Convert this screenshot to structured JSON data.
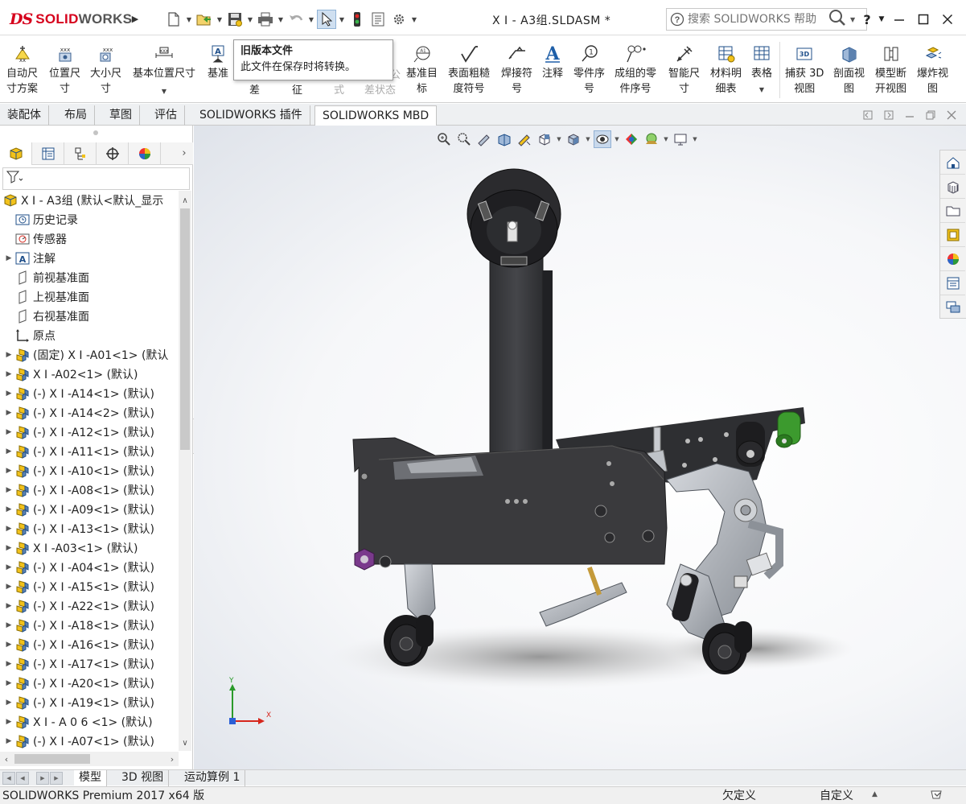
{
  "app": {
    "brand_prefix": "DS",
    "brand_solid": "SOLID",
    "brand_works": "WORKS",
    "document_title": "X I - A3组.SLDASM *",
    "help_placeholder": "搜索 SOLIDWORKS 帮助",
    "help_q": "?"
  },
  "tooltip": {
    "title": "旧版本文件",
    "body": "此文件在保存时将转换。"
  },
  "ribbon": [
    {
      "id": "auto-dim",
      "label1": "自动尺",
      "label2": "寸方案",
      "icon": "auto-dimension-icon"
    },
    {
      "id": "loc-dim",
      "label1": "位置尺",
      "label2": "寸",
      "icon": "location-dimension-icon"
    },
    {
      "id": "size-dim",
      "label1": "大小尺",
      "label2": "寸",
      "icon": "size-dimension-icon"
    },
    {
      "id": "basic-loc-dim",
      "label1": "基本位置尺寸",
      "label2": "",
      "icon": "basic-location-dimension-icon"
    },
    {
      "id": "datum",
      "label1": "基准",
      "label2": "",
      "icon": "datum-icon"
    },
    {
      "id": "datum-target",
      "label1": "基准目",
      "label2": "标",
      "icon": "datum-target-icon"
    },
    {
      "id": "surface-finish",
      "label1": "表面粗糙",
      "label2": "度符号",
      "icon": "surface-finish-icon"
    },
    {
      "id": "weld-symbol",
      "label1": "焊接符",
      "label2": "号",
      "icon": "weld-symbol-icon"
    },
    {
      "id": "note",
      "label1": "注释",
      "label2": "",
      "icon": "note-icon"
    },
    {
      "id": "balloon",
      "label1": "零件序",
      "label2": "号",
      "icon": "balloon-icon"
    },
    {
      "id": "stacked-balloon",
      "label1": "成组的零",
      "label2": "件序号",
      "icon": "stacked-balloon-icon"
    },
    {
      "id": "smart-dim",
      "label1": "智能尺",
      "label2": "寸",
      "icon": "smart-dimension-icon"
    },
    {
      "id": "bom",
      "label1": "材料明",
      "label2": "细表",
      "icon": "bill-of-materials-icon"
    },
    {
      "id": "table",
      "label1": "表格",
      "label2": "",
      "icon": "table-icon"
    },
    {
      "id": "capture-3d",
      "label1": "捕获 3D",
      "label2": "视图",
      "icon": "capture-3d-view-icon"
    },
    {
      "id": "section-view",
      "label1": "剖面视",
      "label2": "图",
      "icon": "section-view-icon"
    },
    {
      "id": "model-break",
      "label1": "模型断",
      "label2": "开视图",
      "icon": "model-break-view-icon"
    },
    {
      "id": "explode-view",
      "label1": "爆炸视",
      "label2": "图",
      "icon": "explode-view-icon"
    }
  ],
  "ribbon_hidden": {
    "row2_a": "差",
    "row2_b": "征",
    "row2_c": "式",
    "row2_d": "差状态",
    "row1_d": "公"
  },
  "command_tabs": [
    "装配体",
    "布局",
    "草图",
    "评估",
    "SOLIDWORKS 插件",
    "SOLIDWORKS MBD"
  ],
  "active_command_tab": "SOLIDWORKS MBD",
  "tree": {
    "root": "X I - A3组 (默认<默认_显示",
    "items": [
      {
        "label": "历史记录",
        "icon": "history-icon",
        "expand": false
      },
      {
        "label": "传感器",
        "icon": "sensor-icon",
        "expand": false
      },
      {
        "label": "注解",
        "icon": "annotations-icon",
        "expand": true
      },
      {
        "label": "前视基准面",
        "icon": "plane-icon",
        "expand": false
      },
      {
        "label": "上视基准面",
        "icon": "plane-icon",
        "expand": false
      },
      {
        "label": "右视基准面",
        "icon": "plane-icon",
        "expand": false
      },
      {
        "label": "原点",
        "icon": "origin-icon",
        "expand": false
      },
      {
        "label": "(固定) X I -A01<1> (默认",
        "icon": "part-icon",
        "expand": true
      },
      {
        "label": " X I -A02<1> (默认)",
        "icon": "part-icon",
        "expand": true
      },
      {
        "label": "(-) X I -A14<1> (默认)",
        "icon": "part-icon",
        "expand": true
      },
      {
        "label": "(-) X I -A14<2> (默认)",
        "icon": "part-icon",
        "expand": true
      },
      {
        "label": "(-) X I -A12<1> (默认)",
        "icon": "part-icon",
        "expand": true
      },
      {
        "label": "(-) X I -A11<1> (默认)",
        "icon": "part-icon",
        "expand": true
      },
      {
        "label": "(-) X I -A10<1> (默认)",
        "icon": "part-icon",
        "expand": true
      },
      {
        "label": "(-) X I -A08<1> (默认)",
        "icon": "part-icon",
        "expand": true
      },
      {
        "label": "(-) X I -A09<1> (默认)",
        "icon": "part-icon",
        "expand": true
      },
      {
        "label": "(-) X I -A13<1> (默认)",
        "icon": "part-icon",
        "expand": true
      },
      {
        "label": " X I -A03<1> (默认)",
        "icon": "part-icon",
        "expand": true
      },
      {
        "label": "(-) X I -A04<1> (默认)",
        "icon": "part-icon",
        "expand": true
      },
      {
        "label": "(-) X I -A15<1> (默认)",
        "icon": "part-icon",
        "expand": true
      },
      {
        "label": "(-) X I -A22<1> (默认)",
        "icon": "part-icon",
        "expand": true
      },
      {
        "label": "(-) X I -A18<1> (默认)",
        "icon": "part-icon",
        "expand": true
      },
      {
        "label": "(-) X I -A16<1> (默认)",
        "icon": "part-icon",
        "expand": true
      },
      {
        "label": "(-) X I -A17<1> (默认)",
        "icon": "part-icon",
        "expand": true
      },
      {
        "label": "(-) X I -A20<1> (默认)",
        "icon": "part-icon",
        "expand": true
      },
      {
        "label": "(-) X I -A19<1> (默认)",
        "icon": "part-icon",
        "expand": true
      },
      {
        "label": " X I - A 0 6 <1> (默认)",
        "icon": "part-icon",
        "expand": true
      },
      {
        "label": "(-) X I -A07<1> (默认)",
        "icon": "part-icon",
        "expand": true
      }
    ]
  },
  "bottom_tabs": [
    "模型",
    "3D 视图",
    "运动算例 1"
  ],
  "active_bottom_tab": "模型",
  "status": {
    "product": "SOLIDWORKS Premium 2017 x64 版",
    "definition": "欠定义",
    "custom": "自定义"
  },
  "triad": {
    "x": "X",
    "y": "Y"
  },
  "colors": {
    "brand_red": "#d6001c",
    "part_dark": "#3a3a3c",
    "part_silver": "#b8bcc2",
    "accent_green": "#3c9a2e",
    "accent_purple": "#7a3a8c"
  }
}
